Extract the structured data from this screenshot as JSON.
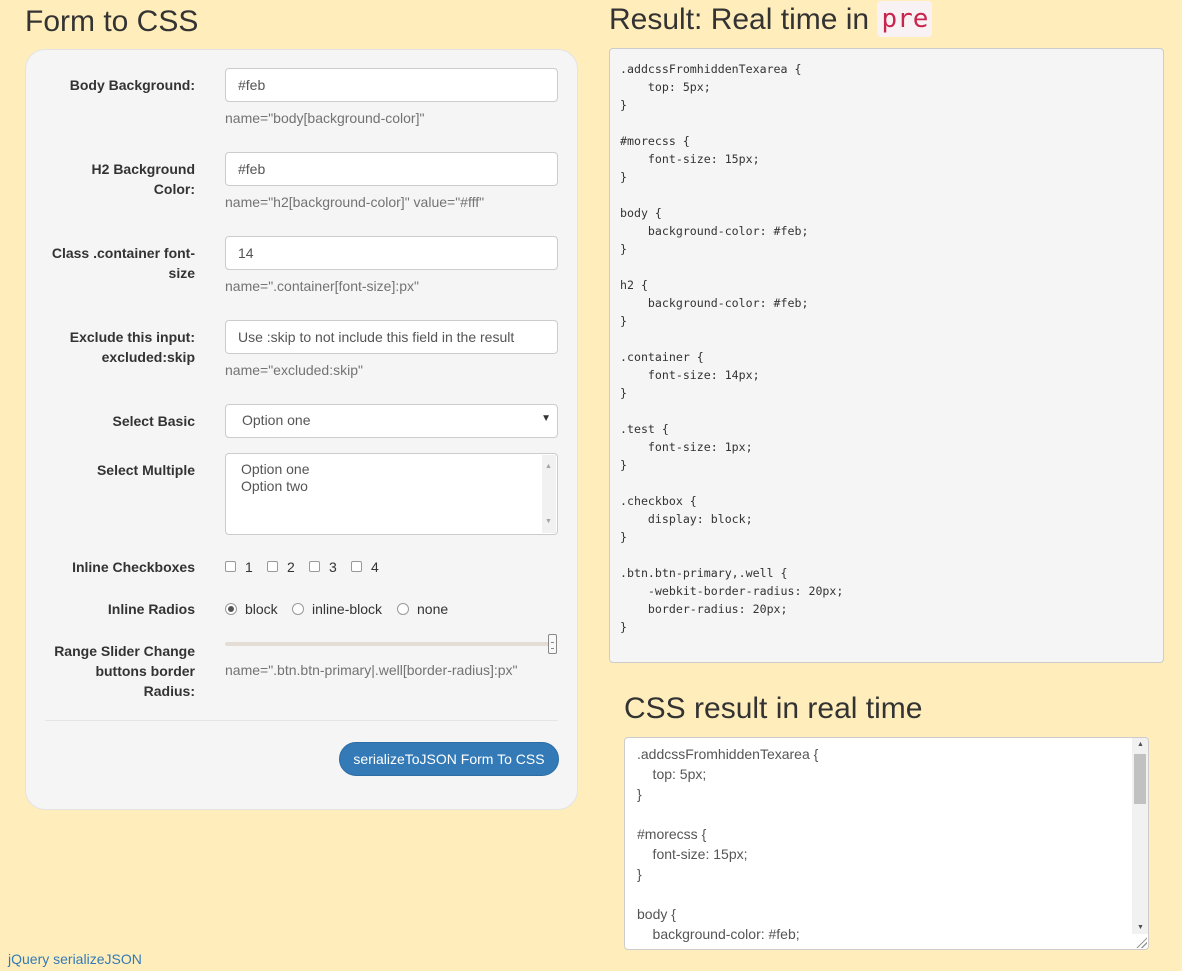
{
  "form": {
    "title": "Form to CSS",
    "body_bg": {
      "label": "Body Background:",
      "value": "#feb",
      "help": "name=\"body[background-color]\""
    },
    "h2_bg": {
      "label_line1": "H2 Background",
      "label_line2": "Color:",
      "value": "#feb",
      "help": "name=\"h2[background-color]\" value=\"#fff\""
    },
    "container_font": {
      "label_line1": "Class .container font-",
      "label_line2": "size",
      "value": "14",
      "help": "name=\".container[font-size]:px\""
    },
    "exclude": {
      "label_line1": "Exclude this input:",
      "label_line2": "excluded:skip",
      "value": "Use :skip to not include this field in the result",
      "help": "name=\"excluded:skip\""
    },
    "select_basic": {
      "label": "Select Basic",
      "selected": "Option one"
    },
    "select_multiple": {
      "label": "Select Multiple",
      "options": [
        "Option one",
        "Option two"
      ]
    },
    "inline_checkboxes": {
      "label": "Inline Checkboxes",
      "items": [
        "1",
        "2",
        "3",
        "4"
      ],
      "checked": [
        false,
        false,
        false,
        false
      ]
    },
    "inline_radios": {
      "label": "Inline Radios",
      "items": [
        "block",
        "inline-block",
        "none"
      ],
      "selected": "block"
    },
    "range": {
      "label_line1": "Range Slider Change",
      "label_line2": "buttons border",
      "label_line3": "Radius:",
      "help": "name=\".btn.btn-primary|.well[border-radius]:px\"",
      "level": 1.0
    },
    "submit_label": "serializeToJSON Form To CSS"
  },
  "result": {
    "title_prefix": "Result: Real time in ",
    "title_code": "pre",
    "pre_text": ".addcssFromhiddenTexarea {\n    top: 5px;\n}\n\n#morecss {\n    font-size: 15px;\n}\n\nbody {\n    background-color: #feb;\n}\n\nh2 {\n    background-color: #feb;\n}\n\n.container {\n    font-size: 14px;\n}\n\n.test {\n    font-size: 1px;\n}\n\n.checkbox {\n    display: block;\n}\n\n.btn.btn-primary,.well {\n    -webkit-border-radius: 20px;\n    border-radius: 20px;\n}"
  },
  "css_result": {
    "title": "CSS result in real time",
    "text": ".addcssFromhiddenTexarea {\n    top: 5px;\n}\n\n#morecss {\n    font-size: 15px;\n}\n\nbody {\n    background-color: #feb;\n}"
  },
  "footer": {
    "link": "jQuery serializeJSON"
  }
}
